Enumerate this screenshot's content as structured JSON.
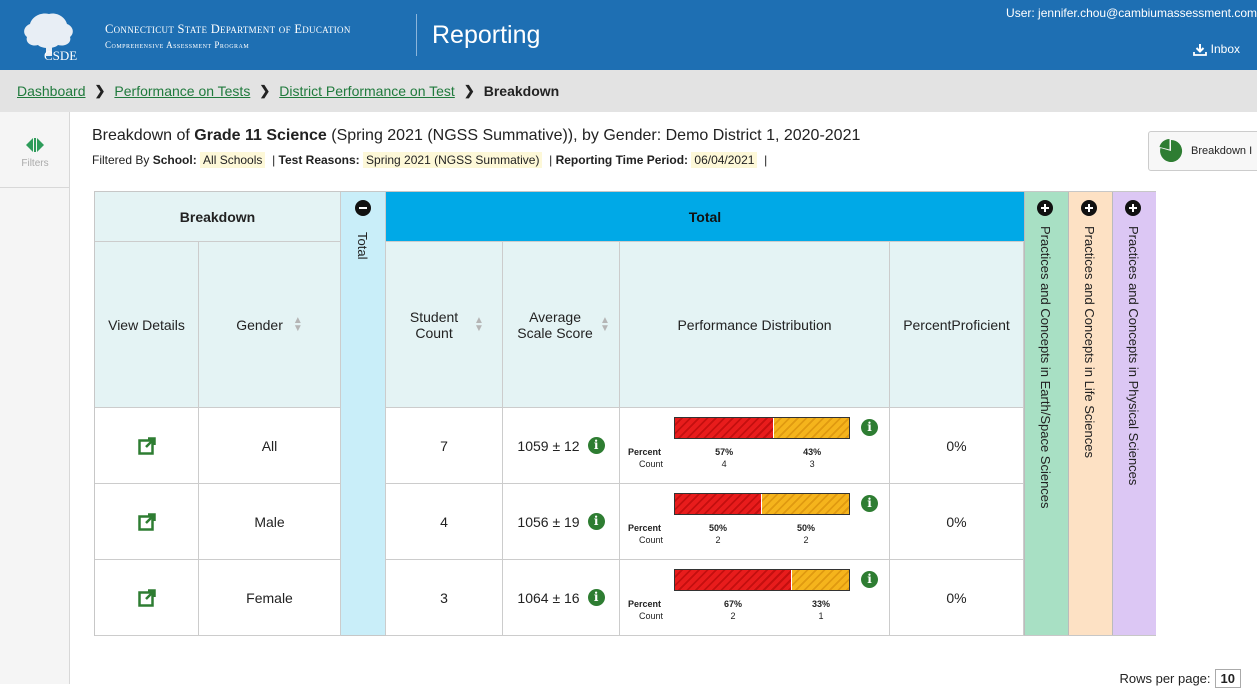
{
  "header": {
    "org_line1": "Connecticut State Department of Education",
    "org_line2": "Comprehensive Assessment Program",
    "logo_text": "CSDE",
    "app_title": "Reporting",
    "user": "User: jennifer.chou@cambiumassessment.com",
    "inbox": "Inbox",
    "color": "#1e6fb3"
  },
  "breadcrumb": {
    "items": [
      "Dashboard",
      "Performance on Tests",
      "District Performance on Test"
    ],
    "current": "Breakdown"
  },
  "left_panel": {
    "filters_label": "Filters"
  },
  "title": {
    "prefix": "Breakdown of ",
    "bold": "Grade 11 Science",
    "suffix": " (Spring 2021 (NGSS Summative)), by Gender: Demo District 1, 2020-2021"
  },
  "filters": {
    "prefix": "Filtered By ",
    "school_label": "School:",
    "school_value": "All Schools",
    "reasons_label": "Test Reasons:",
    "reasons_value": "Spring 2021 (NGSS Summative)",
    "period_label": "Reporting Time Period:",
    "period_value": "06/04/2021"
  },
  "breakdown_button": {
    "label": "Breakdown I"
  },
  "table": {
    "breakdown_header": "Breakdown",
    "total_header": "Total",
    "total_collapsed_label": "Total",
    "columns": {
      "view_details": "View Details",
      "gender": "Gender",
      "student_count": "Student Count",
      "avg_scale_score": "Average Scale Score",
      "performance_distribution": "Performance Distribution",
      "percent_proficient": "PercentProficient"
    },
    "side_columns": [
      {
        "label": "Practices and Concepts in Earth/Space Sciences",
        "color": "#a8e0c4"
      },
      {
        "label": "Practices and Concepts in Life Sciences",
        "color": "#fde1c4"
      },
      {
        "label": "Practices and Concepts in Physical Sciences",
        "color": "#dcc7f4"
      }
    ],
    "dist_labels": {
      "percent": "Percent",
      "count": "Count"
    },
    "rows": [
      {
        "gender": "All",
        "student_count": "7",
        "avg_scale_score": "1059 ± 12",
        "percents": [
          "57%",
          "43%"
        ],
        "fractions": [
          0.57,
          0.43
        ],
        "counts": [
          "4",
          "3"
        ],
        "percent_proficient": "0%"
      },
      {
        "gender": "Male",
        "student_count": "4",
        "avg_scale_score": "1056 ± 19",
        "percents": [
          "50%",
          "50%"
        ],
        "fractions": [
          0.5,
          0.5
        ],
        "counts": [
          "2",
          "2"
        ],
        "percent_proficient": "0%"
      },
      {
        "gender": "Female",
        "student_count": "3",
        "avg_scale_score": "1064 ± 16",
        "percents": [
          "67%",
          "33%"
        ],
        "fractions": [
          0.67,
          0.33
        ],
        "counts": [
          "2",
          "1"
        ],
        "percent_proficient": "0%"
      }
    ]
  },
  "pagination": {
    "rows_per_page_label": "Rows per page:",
    "rows_per_page_value": "10"
  }
}
